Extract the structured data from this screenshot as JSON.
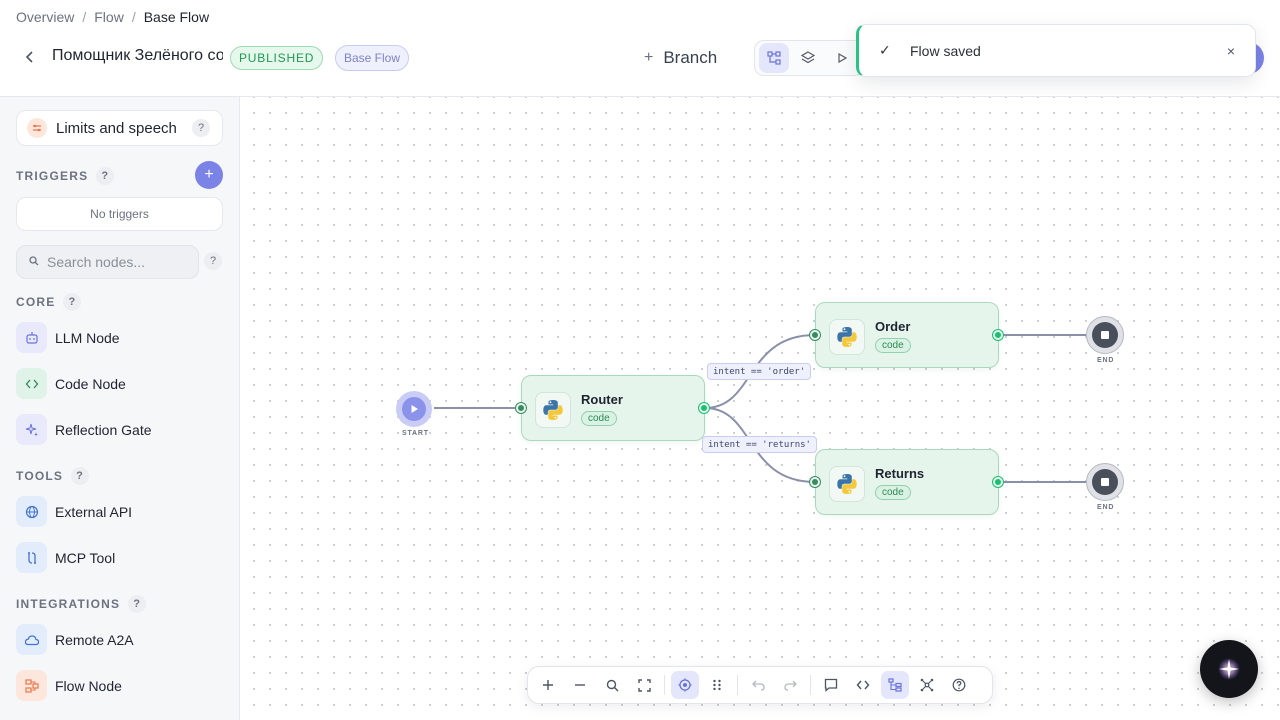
{
  "breadcrumb": {
    "items": [
      "Overview",
      "Flow"
    ],
    "current": "Base Flow",
    "separator": "/"
  },
  "header": {
    "title": "Помощник Зелёного со",
    "status_badge": "PUBLISHED",
    "flow_badge": "Base Flow",
    "branch_label": "Branch",
    "branch_plus": "+"
  },
  "toast": {
    "message": "Flow saved",
    "check": "✓",
    "close": "×"
  },
  "sidebar": {
    "limits_label": "Limits and speech",
    "help": "?",
    "triggers_label": "TRIGGERS",
    "add_trigger": "+",
    "no_triggers": "No triggers",
    "search_placeholder": "Search nodes...",
    "sections": {
      "core": "CORE",
      "tools": "TOOLS",
      "integrations": "INTEGRATIONS"
    },
    "core_items": [
      "LLM Node",
      "Code Node",
      "Reflection Gate"
    ],
    "tool_items": [
      "External API",
      "MCP Tool"
    ],
    "integration_items": [
      "Remote A2A",
      "Flow Node"
    ]
  },
  "canvas": {
    "start_label": "START",
    "end_label": "END",
    "nodes": {
      "router": {
        "title": "Router",
        "tag": "code"
      },
      "order": {
        "title": "Order",
        "tag": "code"
      },
      "returns": {
        "title": "Returns",
        "tag": "code"
      }
    },
    "edge_labels": {
      "order": "intent == 'order'",
      "returns": "intent == 'returns'"
    }
  },
  "colors": {
    "accent": "#7b83e6",
    "node_bg": "#e6f5ec",
    "node_border": "#a9d9bd",
    "success": "#2cc184",
    "published_text": "#1e9a52"
  }
}
